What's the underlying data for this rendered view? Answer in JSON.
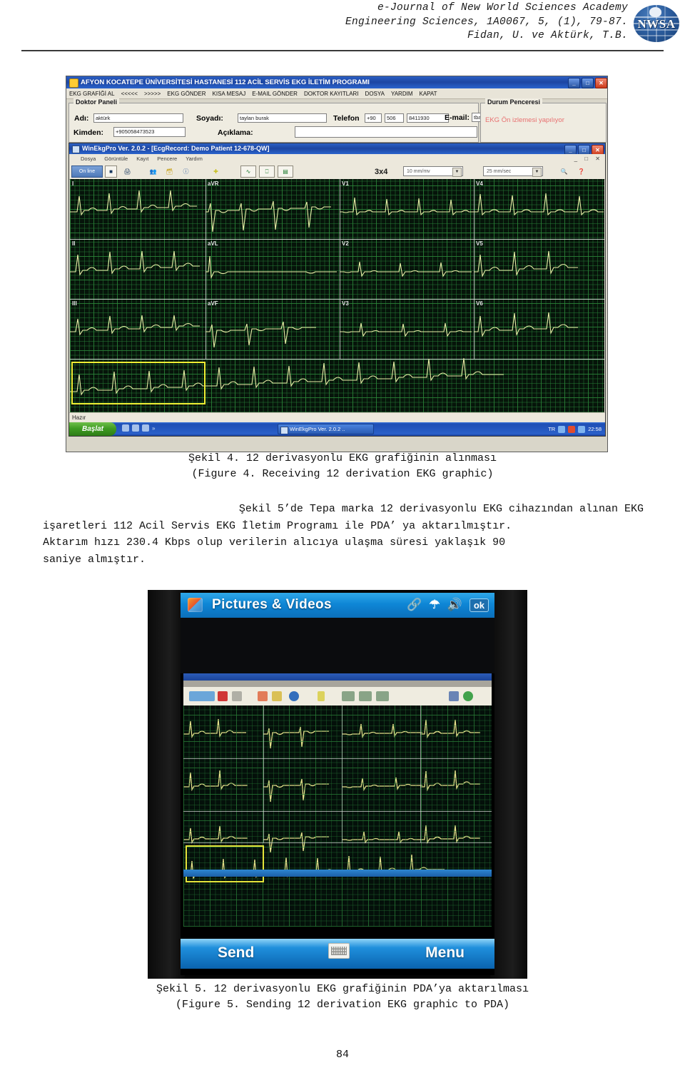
{
  "header": {
    "line1": "e-Journal of New World Sciences Academy",
    "line2": "Engineering Sciences, 1A0067, 5, (1), 79-87.",
    "line3": "Fidan, U. ve Aktürk, T.B.",
    "logo_text": "NWSA"
  },
  "figure4": {
    "outer_window": {
      "title": "AFYON KOCATEPE ÜNİVERSİTESİ HASTANESİ 112 ACİL SERVİS EKG İLETİM PROGRAMI",
      "minimize": "_",
      "maximize": "□",
      "close": "✕",
      "menu": [
        "EKG GRAFİĞİ AL",
        "<<<<<",
        ">>>>>",
        "EKG GÖNDER",
        "KISA MESAJ",
        "E-MAIL GÖNDER",
        "DOKTOR KAYITLARI",
        "DOSYA",
        "YARDIM",
        "KAPAT"
      ]
    },
    "doctor_panel": {
      "legend": "Doktor Paneli",
      "name_label": "Adı:",
      "name_value": "aktürk",
      "surname_label": "Soyadı:",
      "surname_value": "taylan burak",
      "phone_label": "Telefon",
      "phone_country": "+90",
      "phone_area": "506",
      "phone_number": "8411930",
      "email_label": "E-mail:",
      "email_value": "tbakturk@hotmail.com",
      "from_label": "Kimden:",
      "from_value": "+905058473523",
      "note_label": "Açıklama:",
      "note_value": ""
    },
    "status_panel": {
      "legend": "Durum Penceresi",
      "message": "EKG Ön izlemesi yapılıyor",
      "message_color": "#e87070"
    },
    "inner_window": {
      "title": "WinEkgPro Ver. 2.0.2 - [EcgRecord: Demo Patient 12-678-QW]",
      "menu": [
        "Dosya",
        "Görüntüle",
        "Kayıt",
        "Pencere",
        "Yardım"
      ],
      "toolbar": {
        "online_label": "On line",
        "ratio_label": "3x4",
        "gain_value": "10 mm/mv",
        "speed_value": "25 mm/sec"
      },
      "leads": [
        [
          "I",
          "aVR",
          "V1",
          "V4"
        ],
        [
          "II",
          "aVL",
          "V2",
          "V5"
        ],
        [
          "III",
          "aVF",
          "V3",
          "V6"
        ]
      ],
      "status_text": "Hazır",
      "taskbar": {
        "start": "Başlat",
        "task": "WinEkgPro Ver. 2.0.2 ..",
        "locale": "TR",
        "clock": "22:58"
      }
    },
    "caption_tr": "Şekil 4. 12 derivasyonlu EKG grafiğinin alınması",
    "caption_en": "(Figure 4. Receiving 12 derivation EKG graphic)"
  },
  "body": {
    "line1_indent": "Şekil 5’de Tepa marka 12 derivasyonlu EKG cihazından alınan EKG",
    "line2": "işaretleri 112 Acil Servis EKG İletim Programı ile PDA’ ya aktarılmıştır.",
    "line3": "Aktarım hızı 230.4 Kbps olup verilerin alıcıya ulaşma süresi yaklaşık 90",
    "line4": "saniye almıştır."
  },
  "figure5": {
    "pda": {
      "title": "Pictures & Videos",
      "ok_label": "ok",
      "icons": [
        "connectivity-icon",
        "signal-icon",
        "volume-icon"
      ],
      "softkey_left": "Send",
      "softkey_right": "Menu"
    },
    "caption_tr": "Şekil 5.  12 derivasyonlu EKG grafiğinin PDA’ya aktarılması",
    "caption_en": "(Figure 5. Sending 12 derivation EKG graphic to PDA)"
  },
  "page_number": "84"
}
